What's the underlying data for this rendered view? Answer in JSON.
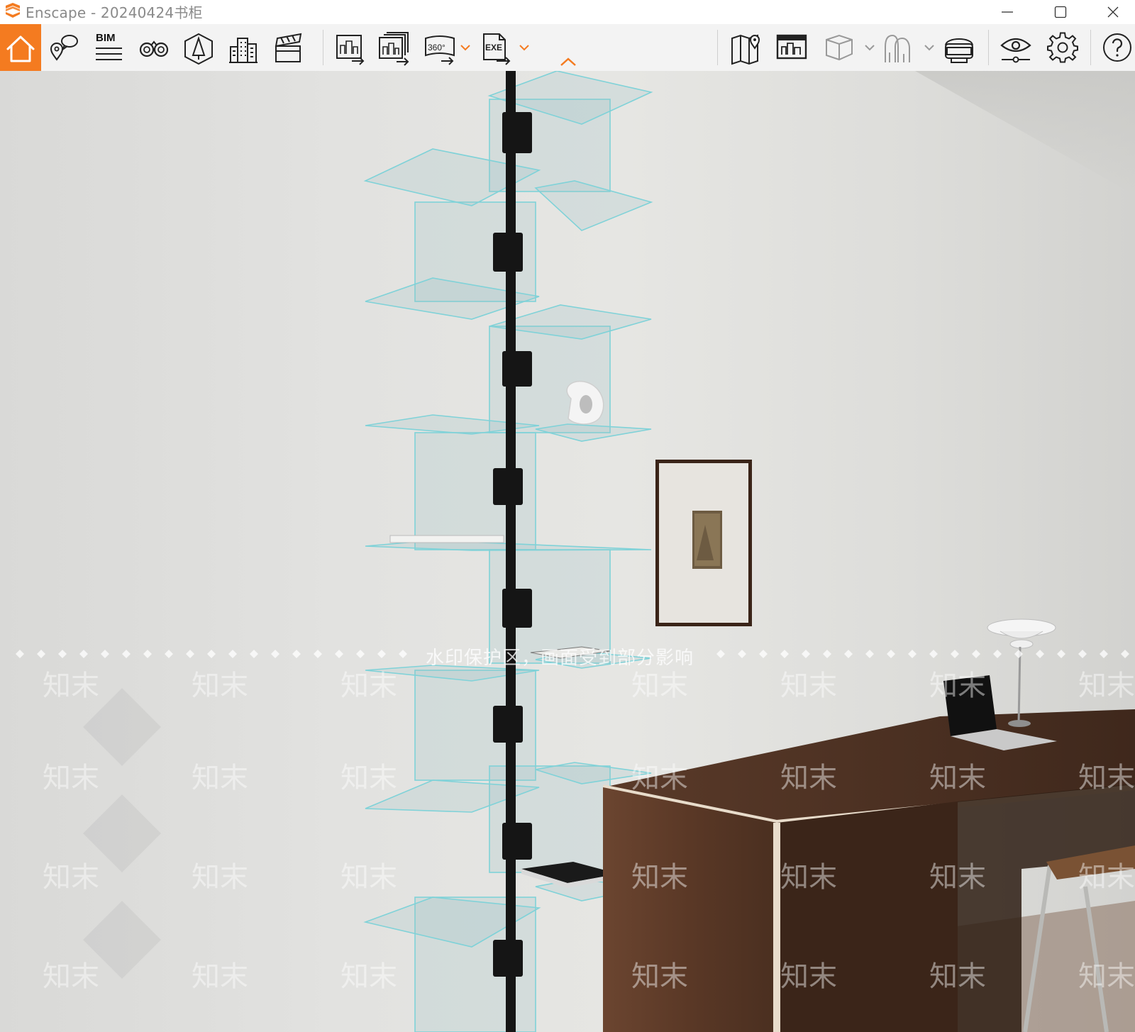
{
  "window": {
    "app_name": "Enscape",
    "title": "Enscape - 20240424书柜",
    "logo_color": "#f47b20"
  },
  "toolbar": {
    "accent": "#f47b20",
    "bim_label": "BIM",
    "items": [
      {
        "name": "home",
        "icon": "home-icon",
        "active": true
      },
      {
        "name": "views",
        "icon": "map-pin-chat-icon"
      },
      {
        "name": "bim",
        "icon": "bim-list-icon"
      },
      {
        "name": "walk-mode",
        "icon": "binoculars-icon"
      },
      {
        "name": "assets",
        "icon": "asset-library-icon"
      },
      {
        "name": "site-context",
        "icon": "buildings-icon"
      },
      {
        "name": "video-editor",
        "icon": "clapperboard-icon"
      },
      {
        "name": "render-image",
        "icon": "render-image-icon"
      },
      {
        "name": "batch-render",
        "icon": "batch-render-icon"
      },
      {
        "name": "render-360",
        "icon": "panorama-360-icon",
        "label": "360°"
      },
      {
        "name": "export-exe",
        "icon": "exe-export-icon",
        "label": "EXE"
      },
      {
        "name": "map",
        "icon": "map-icon"
      },
      {
        "name": "mini-map",
        "icon": "minimap-icon"
      },
      {
        "name": "material-editor",
        "icon": "cube-icon"
      },
      {
        "name": "collaborative",
        "icon": "people-outline-icon"
      },
      {
        "name": "vr-headset",
        "icon": "vr-headset-icon"
      },
      {
        "name": "visual-settings",
        "icon": "eye-settings-icon"
      },
      {
        "name": "general-settings",
        "icon": "gear-icon"
      },
      {
        "name": "help",
        "icon": "help-icon"
      }
    ]
  },
  "viewport": {
    "watermark_text": "水印保护区，画面受到部分影响",
    "watermark_logo": "知末"
  }
}
